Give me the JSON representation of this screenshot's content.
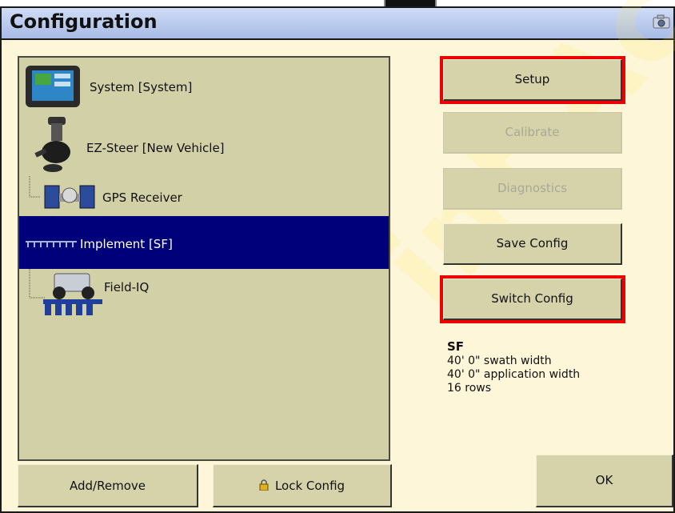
{
  "window": {
    "title": "Configuration"
  },
  "tree": {
    "items": [
      {
        "label": "System [System]",
        "icon": "display-icon"
      },
      {
        "label": "EZ-Steer [New Vehicle]",
        "icon": "steering-motor-icon"
      },
      {
        "label": "GPS Receiver",
        "icon": "satellite-icon"
      },
      {
        "label": "Implement [SF]",
        "icon": "implement-icon",
        "selected": true
      },
      {
        "label": "Field-IQ",
        "icon": "planter-icon"
      }
    ]
  },
  "buttons": {
    "setup": "Setup",
    "calibrate": "Calibrate",
    "diagnostics": "Diagnostics",
    "save_config": "Save Config",
    "switch_config": "Switch Config",
    "add_remove": "Add/Remove",
    "lock_config": "Lock Config",
    "ok": "OK"
  },
  "info": {
    "name": "SF",
    "swath": "40' 0\" swath width",
    "application": "40' 0\" application width",
    "rows": "16 rows"
  },
  "watermark": "int Ac",
  "colors": {
    "selected": "#00007a",
    "highlight": "#ee0000",
    "background": "#fdf6d8",
    "panel": "#d2d0a6"
  }
}
